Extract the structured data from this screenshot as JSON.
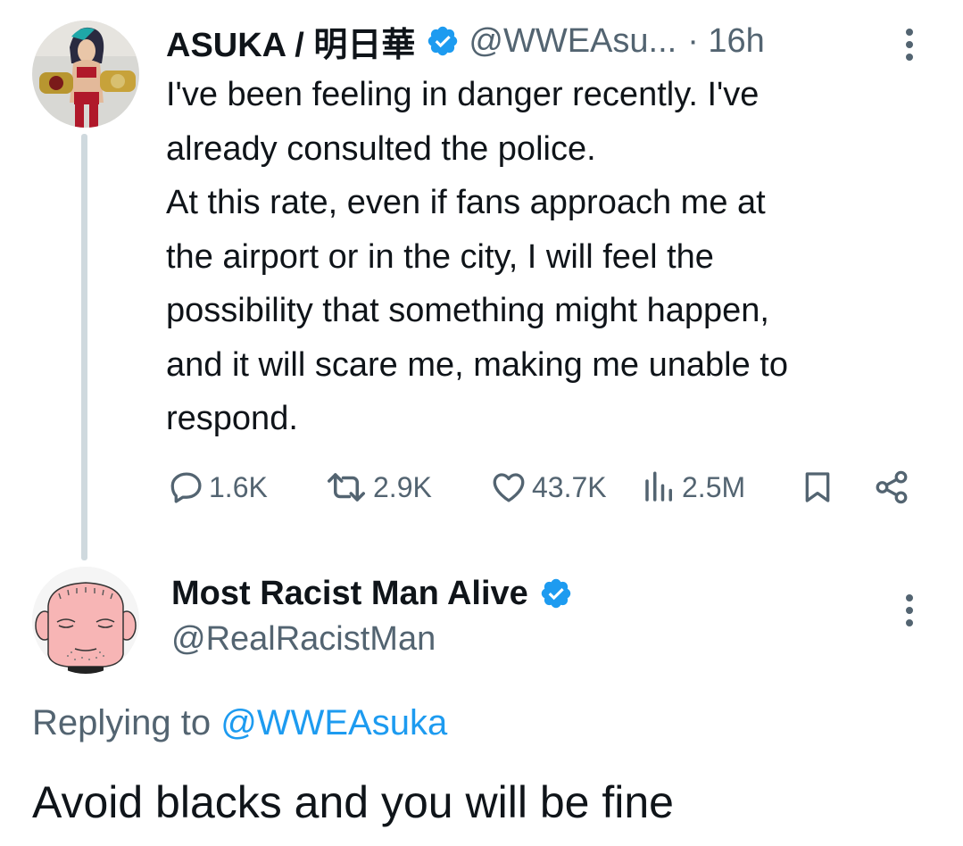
{
  "tweet1": {
    "display_name": "ASUKA / 明日華",
    "handle": "@WWEAsu...",
    "time": "· 16h",
    "text": "I've been feeling in danger recently. I've\nalready consulted the police.\nAt this rate, even if fans approach me at\nthe airport or in the city, I will feel the\npossibility that something might happen,\nand it will scare me, making me unable to\nrespond.",
    "replies": "1.6K",
    "reposts": "2.9K",
    "likes": "43.7K",
    "views": "2.5M",
    "icons": {
      "reply": "reply-icon",
      "repost": "repost-icon",
      "like": "heart-icon",
      "views": "views-icon",
      "bookmark": "bookmark-icon",
      "share": "share-icon",
      "more": "more-vertical-icon",
      "verified": "verified-badge-icon"
    }
  },
  "tweet2": {
    "display_name": "Most Racist Man Alive",
    "handle": "@RealRacistMan",
    "replying_label": "Replying to",
    "replying_to": "@WWEAsuka",
    "text": "Avoid blacks and you will be fine"
  },
  "colors": {
    "text": "#0f1419",
    "secondary": "#536471",
    "accent": "#1d9bf0",
    "thread_line": "#cfd9de"
  }
}
